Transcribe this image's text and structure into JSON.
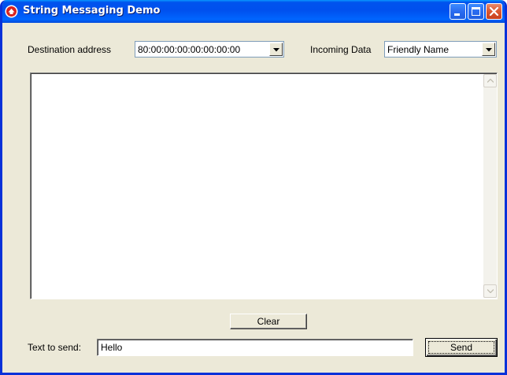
{
  "window": {
    "title": "String Messaging Demo"
  },
  "destination": {
    "label": "Destination address",
    "selected": "80:00:00:00:00:00:00:00"
  },
  "incoming": {
    "label": "Incoming Data",
    "selected": "Friendly Name"
  },
  "messages": {
    "content": ""
  },
  "buttons": {
    "clear_label": "Clear",
    "send_label": "Send"
  },
  "send_text": {
    "label": "Text to send:",
    "value": "Hello"
  },
  "icons": {
    "app": "app-logo-icon",
    "minimize": "minimize-icon",
    "maximize": "maximize-icon",
    "close": "close-icon",
    "dropdown": "chevron-down-icon",
    "scroll_up": "scroll-up-arrow-icon",
    "scroll_down": "scroll-down-arrow-icon"
  },
  "colors": {
    "titlebar": "#0054e3",
    "window_bg": "#ece9d8",
    "close_button": "#dd5a33"
  }
}
